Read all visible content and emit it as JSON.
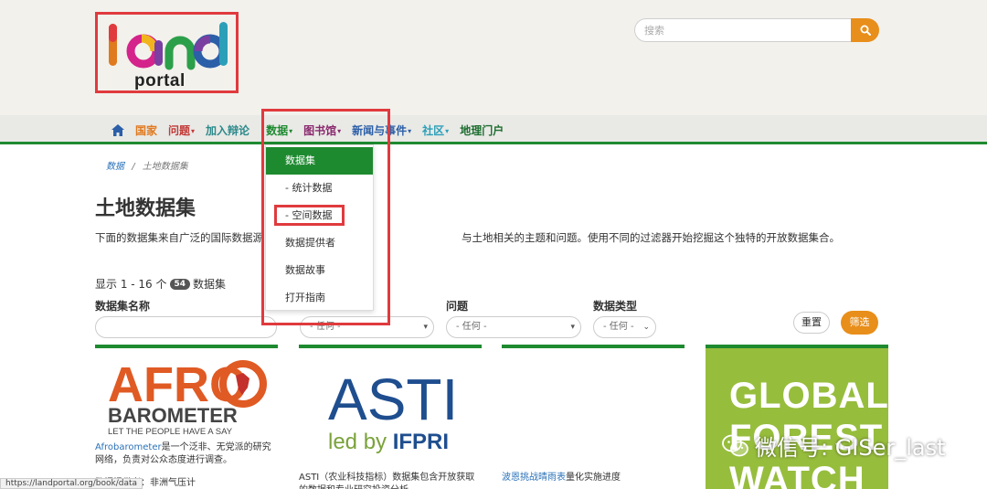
{
  "logo": {
    "portal_text": "portal"
  },
  "search": {
    "placeholder": "搜索"
  },
  "nav": {
    "items": [
      {
        "label": "国家",
        "color": "#e07a1f",
        "caret": ""
      },
      {
        "label": "问题",
        "color": "#c23b37",
        "caret": "▾"
      },
      {
        "label": "加入辩论",
        "color": "#2b8a8a",
        "caret": ""
      },
      {
        "label": "数据",
        "color": "#1e8a30",
        "caret": "▾"
      },
      {
        "label": "图书馆",
        "color": "#8a2a6e",
        "caret": "▾"
      },
      {
        "label": "新闻与事件",
        "color": "#2b5fa8",
        "caret": "▾"
      },
      {
        "label": "社区",
        "color": "#2b9fb8",
        "caret": "▾"
      },
      {
        "label": "地理门户",
        "color": "#1e6e30",
        "caret": ""
      }
    ]
  },
  "dropdown": {
    "items": [
      "数据集",
      "- 统计数据",
      "- 空间数据",
      "数据提供者",
      "数据故事",
      "打开指南"
    ]
  },
  "breadcrumb": {
    "link": "数据",
    "sep": "/",
    "current": "土地数据集"
  },
  "page": {
    "title": "土地数据集",
    "intro_a": "下面的数据集来自广泛的国际数据源",
    "intro_b": "与土地相关的主题和问题。使用不同的过滤器开始挖掘这个独特的开放数据集合。",
    "count_prefix": "显示 1 - 16 个",
    "count_badge": "54",
    "count_suffix": "数据集"
  },
  "filters": {
    "name_label": "数据集名称",
    "issue_label": "问题",
    "type_label": "数据类型",
    "any": "- 任何 -",
    "reset": "重置",
    "submit": "筛选"
  },
  "cards": {
    "afro": {
      "logo_line1": "AFRO",
      "logo_line2": "BAROMETER",
      "logo_line3": "LET THE PEOPLE HAVE A SAY",
      "link": "Afrobarometer",
      "desc": "是一个泛非、无党派的研究网络，负责对公众态度进行调查。",
      "provider": "数据提供者：非洲气压计"
    },
    "asti": {
      "logo_line1": "ASTI",
      "logo_line2a": "led by ",
      "logo_line2b": "IFPRI",
      "desc": "ASTI（农业科技指标）数据集包含开放获取的数据和专业研究投资分析"
    },
    "third": {
      "link": "波恩挑战晴雨表",
      "desc": "量化实施进度"
    },
    "gfw": {
      "line1": "GLOBAL",
      "line2": "FOREST",
      "line3": "WATCH"
    }
  },
  "status": {
    "url": "https://landportal.org/book/data"
  },
  "watermark": {
    "text": "微信号: GISer_last"
  }
}
